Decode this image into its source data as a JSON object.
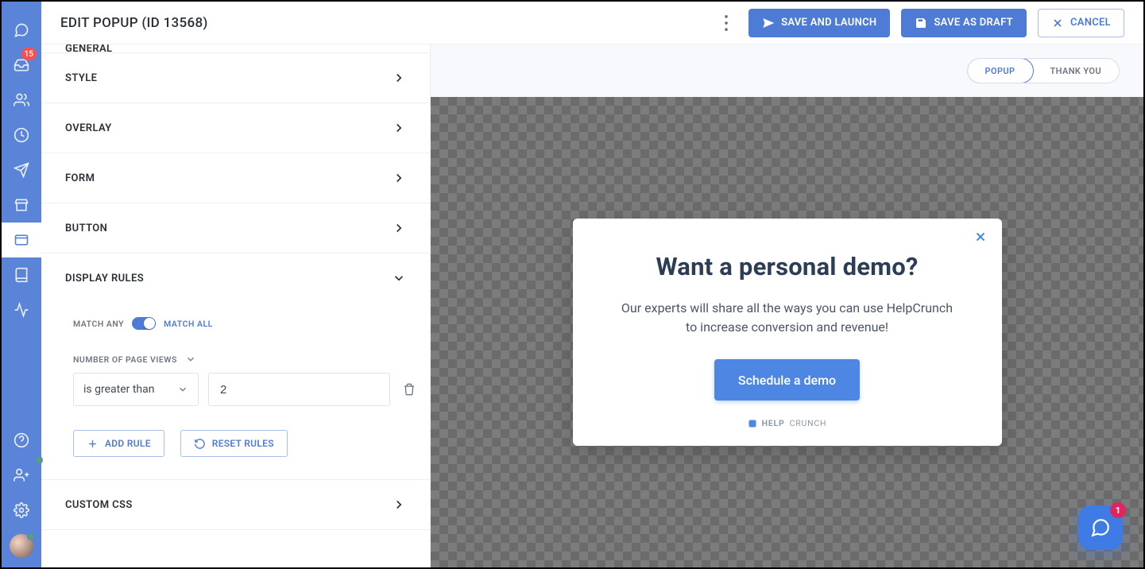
{
  "header": {
    "title": "EDIT POPUP (ID 13568)",
    "save_launch": "SAVE AND LAUNCH",
    "save_draft": "SAVE AS DRAFT",
    "cancel": "CANCEL"
  },
  "sidebar": {
    "inbox_badge": "15",
    "user_status_badge": "1"
  },
  "sections": {
    "general": "GENERAL",
    "style": "STYLE",
    "overlay": "OVERLAY",
    "form": "FORM",
    "button": "BUTTON",
    "display_rules": "DISPLAY RULES",
    "custom_css": "CUSTOM CSS"
  },
  "rules": {
    "match_any": "MATCH ANY",
    "match_all": "MATCH ALL",
    "field_label": "NUMBER OF PAGE VIEWS",
    "operator": "is greater than",
    "value": "2",
    "add_rule": "ADD RULE",
    "reset_rules": "RESET RULES"
  },
  "preview_tabs": {
    "popup": "POPUP",
    "thankyou": "THANK YOU"
  },
  "popup": {
    "title": "Want a personal demo?",
    "text": "Our experts will share all the ways you can use HelpCrunch to increase conversion and revenue!",
    "cta": "Schedule a demo",
    "brand_bold": "HELP",
    "brand_rest": "CRUNCH"
  },
  "chat": {
    "badge": "1"
  }
}
